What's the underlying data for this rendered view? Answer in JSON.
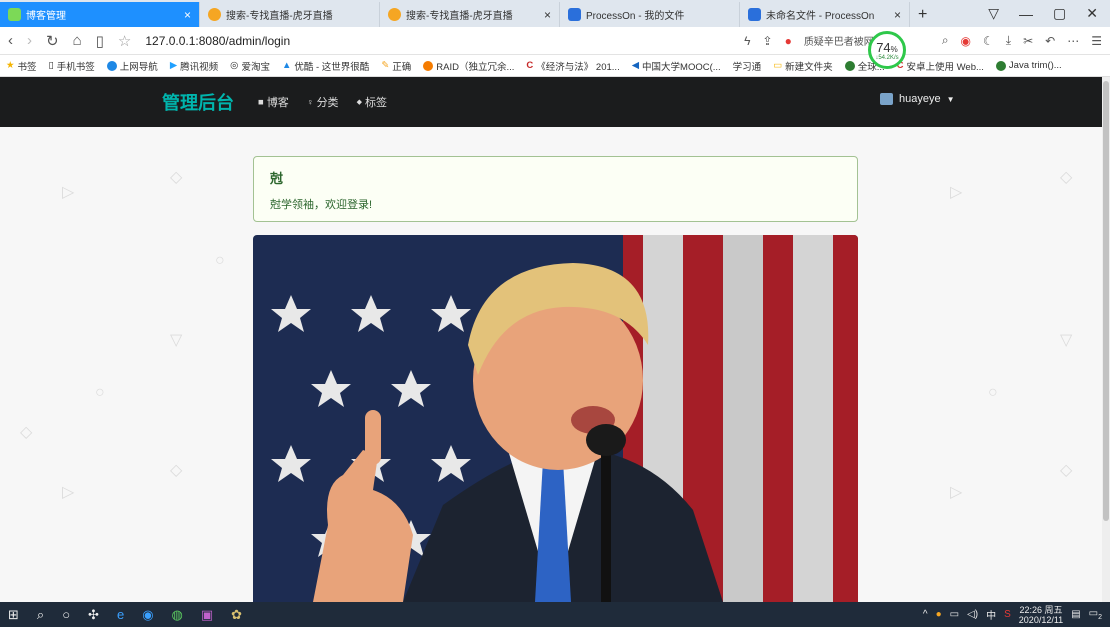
{
  "browser": {
    "tabs": [
      {
        "label": "博客管理",
        "active": true,
        "icon": "leaf-icon",
        "color": "#7cd957"
      },
      {
        "label": "搜索-专找直播-虎牙直播",
        "icon": "huya-icon",
        "color": "#f5a623"
      },
      {
        "label": "搜索-专找直播-虎牙直播",
        "icon": "huya-icon",
        "color": "#f5a623"
      },
      {
        "label": "ProcessOn - 我的文件",
        "icon": "processon-icon",
        "color": "#2a6fdb"
      },
      {
        "label": "未命名文件 - ProcessOn",
        "icon": "processon-icon",
        "color": "#2a6fdb"
      }
    ],
    "new_tab": "+",
    "close_glyph": "×",
    "url": "127.0.0.1:8080/admin/login",
    "search_suggest": "质疑辛巴者被网暴",
    "speed": {
      "percent": "74",
      "unit": "%",
      "rate": "↓54.2K/s"
    },
    "bookmarks": [
      {
        "label": "书签",
        "color": "#f5b400"
      },
      {
        "label": "手机书签",
        "color": "#888"
      },
      {
        "label": "上网导航",
        "color": "#1e88e5"
      },
      {
        "label": "腾讯视频",
        "color": "#20a0ff"
      },
      {
        "label": "爱淘宝",
        "color": "#888"
      },
      {
        "label": "优酷 - 这世界很酷",
        "color": "#1e88e5"
      },
      {
        "label": "正确",
        "color": "#f5a623"
      },
      {
        "label": "RAID（独立冗余...",
        "color": "#f57c00"
      },
      {
        "label": "《经济与法》 201...",
        "color": "#c62828"
      },
      {
        "label": "中国大学MOOC(...",
        "color": "#1565c0"
      },
      {
        "label": "学习通",
        "color": "#888"
      },
      {
        "label": "新建文件夹",
        "color": "#f5b400"
      },
      {
        "label": "全球...",
        "color": "#2e7d32"
      },
      {
        "label": "安卓上使用 Web...",
        "color": "#d32f2f"
      },
      {
        "label": "Java trim()...",
        "color": "#2e7d32"
      }
    ]
  },
  "site": {
    "brand": "管理后台",
    "menu": [
      {
        "label": "博客",
        "icon": "home-icon",
        "glyph": "◼"
      },
      {
        "label": "分类",
        "icon": "idea-icon",
        "glyph": "♀"
      },
      {
        "label": "标签",
        "icon": "tags-icon",
        "glyph": "◆"
      }
    ],
    "user": "huayeye",
    "message_title": "尅",
    "message_text": "尅学领袖，欢迎登录!"
  },
  "taskbar": {
    "time": "22:26 周五",
    "date": "2020/12/11",
    "ime": "中",
    "notifications": "2"
  }
}
